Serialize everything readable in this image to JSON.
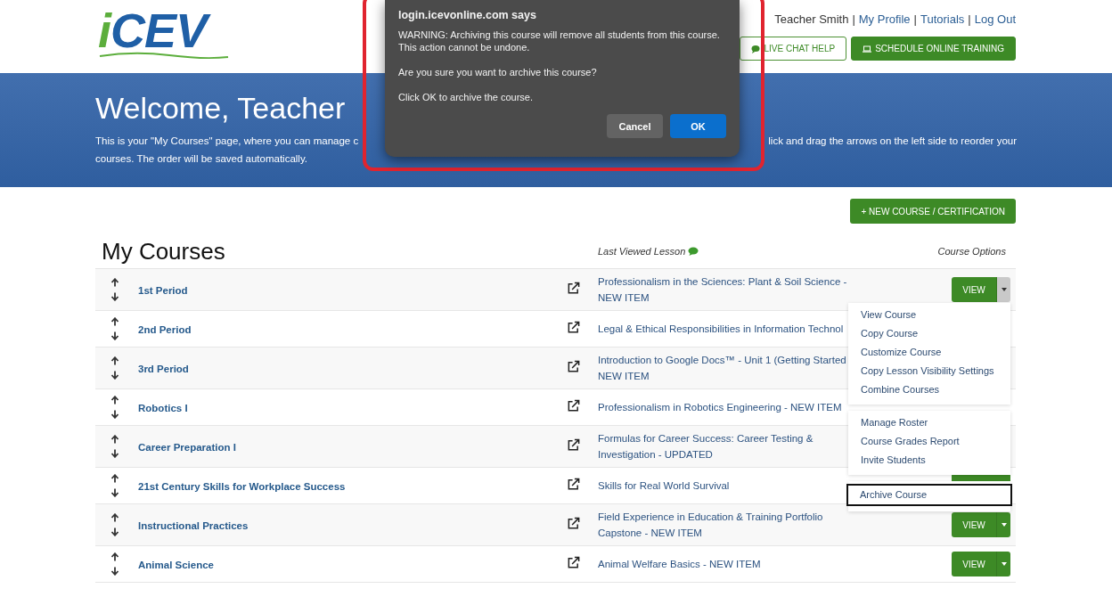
{
  "header": {
    "logo": {
      "accent": "i",
      "main": "CEV"
    },
    "user_name": "Teacher Smith",
    "separator": "|",
    "links": [
      "My Profile",
      "Tutorials",
      "Log Out"
    ],
    "buttons": [
      {
        "kind": "outline",
        "label": "LIVE CHAT HELP"
      },
      {
        "kind": "solid",
        "label": "SCHEDULE ONLINE TRAINING"
      }
    ]
  },
  "banner": {
    "title": "Welcome, Teacher",
    "intro_left": "This is your \"My Courses\" page, where you can manage c",
    "intro_right": "lick and drag the arrows on the left side to reorder your",
    "intro_line2": "courses. The order will be saved automatically."
  },
  "new_course_button": "+ NEW COURSE / CERTIFICATION",
  "courses": {
    "title": "My Courses",
    "last_viewed_heading": "Last Viewed Lesson",
    "options_heading": "Course Options",
    "rows": [
      {
        "name": "1st Period",
        "lesson": [
          "Professionalism in the Sciences: Plant & Soil Science -",
          "NEW ITEM"
        ],
        "options": {
          "kind": "button",
          "label": "VIEW",
          "open": true
        }
      },
      {
        "name": "2nd Period",
        "lesson": [
          "Legal & Ethical Responsibilities in Information Technol"
        ]
      },
      {
        "name": "3rd Period",
        "lesson": [
          "Introduction to Google Docs™ - Unit 1 (Getting Started",
          "NEW ITEM"
        ]
      },
      {
        "name": "Robotics I",
        "lesson": [
          "Professionalism in Robotics Engineering - NEW ITEM"
        ]
      },
      {
        "name": "Career Preparation I",
        "lesson": [
          "Formulas for Career Success: Career Testing &",
          "Investigation - UPDATED"
        ]
      },
      {
        "name": "21st Century Skills for Workplace Success",
        "lesson": [
          "Skills for Real World Survival"
        ],
        "options": {
          "kind": "covered"
        }
      },
      {
        "name": "Instructional Practices",
        "lesson": [
          "Field Experience in Education & Training Portfolio",
          "Capstone - NEW ITEM"
        ],
        "options": {
          "kind": "button",
          "label": "VIEW",
          "open": false
        }
      },
      {
        "name": "Animal Science",
        "lesson": [
          "Animal Welfare Basics - NEW ITEM"
        ],
        "options": {
          "kind": "button",
          "label": "VIEW",
          "open": false
        }
      }
    ]
  },
  "options_menu": {
    "groups": [
      [
        {
          "label": "View Course",
          "selected": false
        },
        {
          "label": "Copy Course",
          "selected": false
        },
        {
          "label": "Customize Course",
          "selected": false
        },
        {
          "label": "Copy Lesson Visibility Settings",
          "selected": false
        },
        {
          "label": "Combine Courses",
          "selected": false
        }
      ],
      [
        {
          "label": "Manage Roster",
          "selected": false
        },
        {
          "label": "Course Grades Report",
          "selected": false
        },
        {
          "label": "Invite Students",
          "selected": false
        }
      ],
      [
        {
          "label": "Archive Course",
          "selected": true
        }
      ]
    ]
  },
  "dialog": {
    "title": "login.icevonline.com says",
    "paragraphs": [
      "WARNING: Archiving this course will remove all students from this course. This action cannot be undone.",
      "Are you sure you want to archive this course?",
      "Click OK to archive the course."
    ],
    "buttons": [
      {
        "kind": "secondary",
        "label": "Cancel"
      },
      {
        "kind": "primary",
        "label": "OK"
      }
    ]
  }
}
